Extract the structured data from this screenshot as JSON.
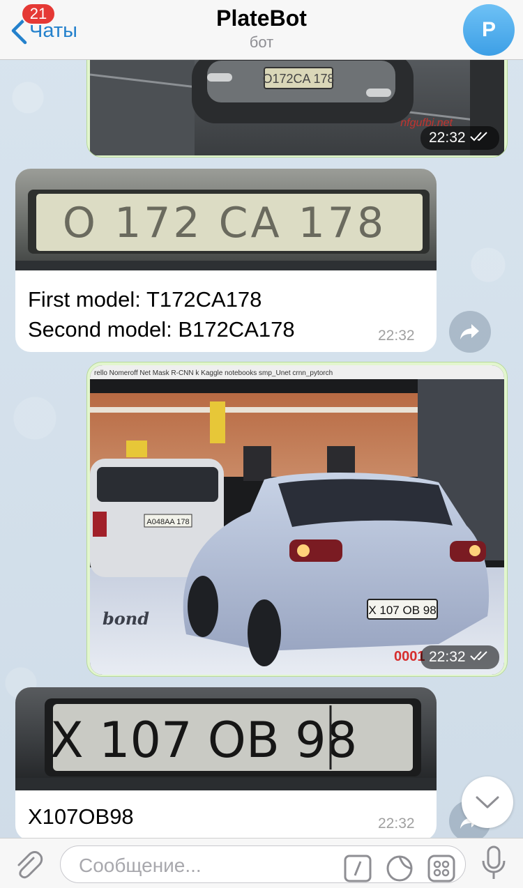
{
  "header": {
    "back_label": "Чаты",
    "badge_count": "21",
    "title": "PlateBot",
    "subtitle": "бот",
    "avatar_letter": "P"
  },
  "messages": [
    {
      "id": "m1",
      "type": "photo-out",
      "time": "22:32",
      "watermark": "nfgufbi.net"
    },
    {
      "id": "m2",
      "type": "photo-in",
      "plate_text": "O 172 CA 178",
      "line1": "First model: T172CA178",
      "line2": "Second model: B172CA178",
      "time": "22:32"
    },
    {
      "id": "m3",
      "type": "photo-out",
      "time": "22:32",
      "browser_tabs": "rello   Nomeroff Net   Mask R-CNN   k Kaggle   notebooks   smp_Unet   crnn_pytorch",
      "plate_front": "A048AA 178",
      "plate_rear": "X 107 OB 98",
      "bond": "bond",
      "corner_text": "0001"
    },
    {
      "id": "m4",
      "type": "photo-in",
      "plate_text": "X 107 OB 98",
      "line1": "X107OB98",
      "time": "22:32"
    }
  ],
  "input": {
    "placeholder": "Сообщение..."
  },
  "icons": [
    "back-chevron-icon",
    "avatar",
    "share-icon",
    "double-check-icon",
    "chevron-down-icon",
    "paperclip-icon",
    "command-icon",
    "sticker-icon",
    "keyboard-grid-icon",
    "microphone-icon"
  ],
  "colors": {
    "accent": "#2481cc",
    "badge": "#e53935",
    "outgoing_bubble": "#e2f6ce",
    "background": "#d6e2ec"
  }
}
